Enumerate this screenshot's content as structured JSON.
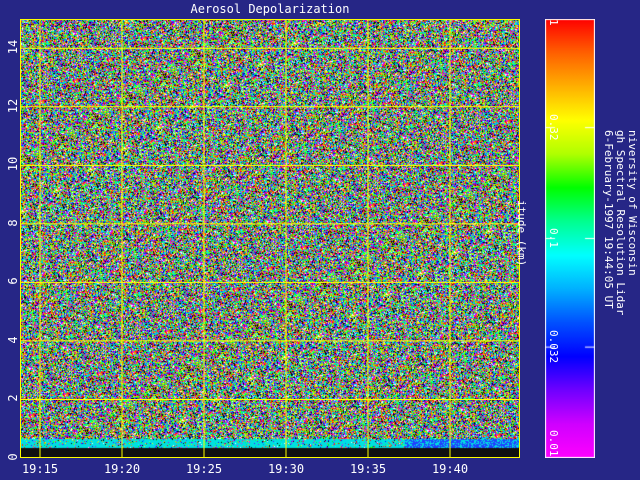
{
  "chart_data": {
    "type": "heatmap",
    "title": "Aerosol Depolarization",
    "ylabel": "itude (km)",
    "x_ticks": [
      "19:15",
      "19:20",
      "19:25",
      "19:30",
      "19:35",
      "19:40"
    ],
    "y_ticks": [
      "0",
      "2",
      "4",
      "6",
      "8",
      "10",
      "12",
      "14"
    ],
    "ylim": [
      0,
      15
    ],
    "colorbar": {
      "scale": "log",
      "range": [
        0.01,
        1
      ],
      "ticks": [
        "1",
        "0.32",
        "0.1",
        "0.032",
        "0.01"
      ]
    },
    "grid": true,
    "grid_color": "#ffff00"
  },
  "info": {
    "line1": "niversity of Wisconsin",
    "line2": "gh Spectral Resolution Lidar",
    "line3": "6-February-1997 19:44:05 UT"
  }
}
